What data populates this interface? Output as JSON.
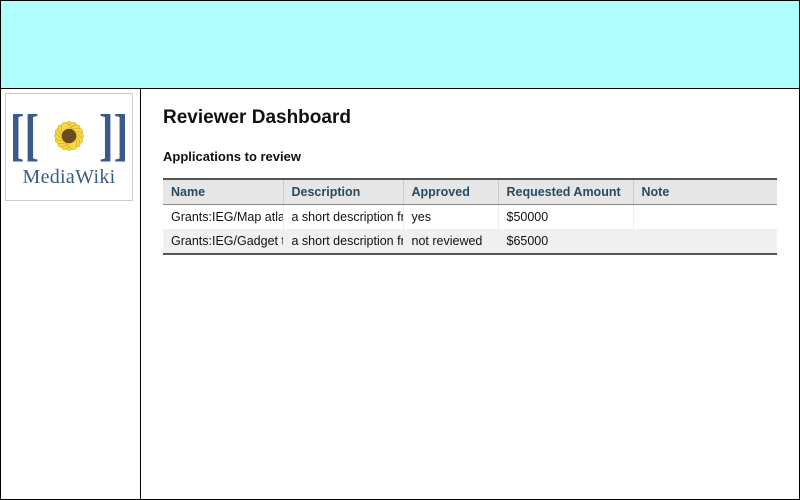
{
  "brand": {
    "name": "MediaWiki"
  },
  "page": {
    "title": "Reviewer Dashboard",
    "subtitle": "Applications to review"
  },
  "table": {
    "headers": {
      "name": "Name",
      "description": "Description",
      "approved": "Approved",
      "amount": "Requested Amount",
      "note": "Note"
    },
    "rows": [
      {
        "name": "Grants:IEG/Map atlas",
        "description": "a short description fro",
        "approved": "yes",
        "amount": "$50000",
        "note": ""
      },
      {
        "name": "Grants:IEG/Gadget to",
        "description": "a short description fro",
        "approved": "not reviewed",
        "amount": "$65000",
        "note": ""
      }
    ]
  }
}
